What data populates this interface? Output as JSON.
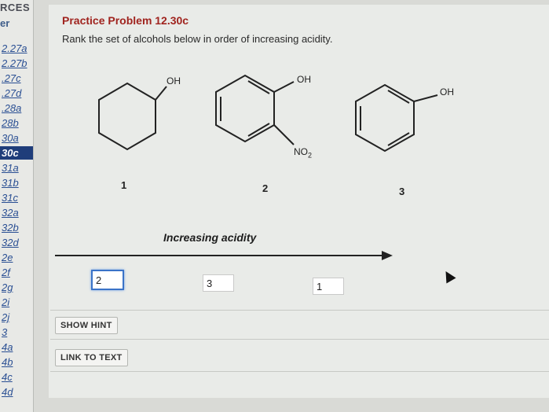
{
  "sidebar": {
    "header": "RCES",
    "sub": "er",
    "items": [
      {
        "label": "2.27a",
        "active": false
      },
      {
        "label": "2.27b",
        "active": false
      },
      {
        "label": ".27c",
        "active": false
      },
      {
        "label": ".27d",
        "active": false
      },
      {
        "label": ".28a",
        "active": false
      },
      {
        "label": "28b",
        "active": false
      },
      {
        "label": "30a",
        "active": false
      },
      {
        "label": "30c",
        "active": true
      },
      {
        "label": "31a",
        "active": false
      },
      {
        "label": "31b",
        "active": false
      },
      {
        "label": "31c",
        "active": false
      },
      {
        "label": "32a",
        "active": false
      },
      {
        "label": "32b",
        "active": false
      },
      {
        "label": "32d",
        "active": false
      },
      {
        "label": "2e",
        "active": false
      },
      {
        "label": "2f",
        "active": false
      },
      {
        "label": "2g",
        "active": false
      },
      {
        "label": "2i",
        "active": false
      },
      {
        "label": "2j",
        "active": false
      },
      {
        "label": "3",
        "active": false
      },
      {
        "label": "4a",
        "active": false
      },
      {
        "label": "4b",
        "active": false
      },
      {
        "label": "4c",
        "active": false
      },
      {
        "label": "4d",
        "active": false
      }
    ]
  },
  "problem": {
    "title": "Practice Problem 12.30c",
    "prompt": "Rank the set of alcohols below in order of increasing acidity."
  },
  "molecules": {
    "m1": {
      "oh": "OH",
      "number": "1"
    },
    "m2": {
      "oh": "OH",
      "no2": "NO",
      "no2_sub": "2",
      "number": "2"
    },
    "m3": {
      "oh": "OH",
      "number": "3"
    }
  },
  "ranking": {
    "label": "Increasing acidity",
    "answers": [
      "2",
      "3",
      "1"
    ]
  },
  "buttons": {
    "hint": "SHOW HINT",
    "link": "LINK TO TEXT"
  },
  "colors": {
    "title": "#a0241f",
    "link": "#2a4f93",
    "active": "#1f3d7a",
    "focus": "#3a73c8"
  }
}
